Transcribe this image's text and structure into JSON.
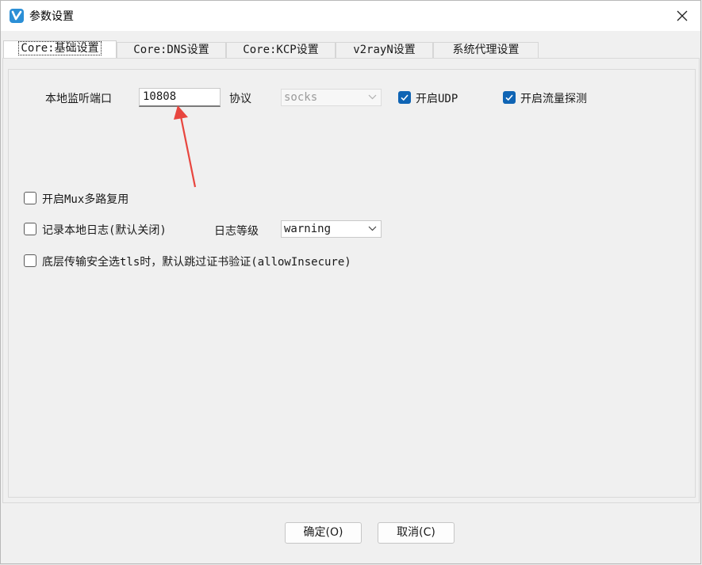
{
  "window": {
    "title": "参数设置"
  },
  "tabs": [
    {
      "label": "Core:基础设置",
      "active": true
    },
    {
      "label": "Core:DNS设置",
      "active": false
    },
    {
      "label": "Core:KCP设置",
      "active": false
    },
    {
      "label": "v2rayN设置",
      "active": false
    },
    {
      "label": "系统代理设置",
      "active": false
    }
  ],
  "core_basic": {
    "local_port_label": "本地监听端口",
    "local_port_value": "10808",
    "protocol_label": "协议",
    "protocol_value": "socks",
    "udp_label": "开启UDP",
    "udp_checked": true,
    "sniffing_label": "开启流量探测",
    "sniffing_checked": true,
    "mux_label": "开启Mux多路复用",
    "mux_checked": false,
    "log_label": "记录本地日志(默认关闭)",
    "log_checked": false,
    "log_level_label": "日志等级",
    "log_level_value": "warning",
    "allow_insecure_label": "底层传输安全选tls时，默认跳过证书验证(allowInsecure)",
    "allow_insecure_checked": false
  },
  "buttons": {
    "ok_label": "确定(O)",
    "cancel_label": "取消(C)"
  },
  "colors": {
    "accent": "#0f64b4",
    "annotation": "#e8463f",
    "app_icon": "#2b8fd6"
  },
  "icons": [
    "app-logo-icon",
    "close-icon",
    "chevron-down-icon",
    "checkmark-icon",
    "red-arrow-annotation"
  ]
}
